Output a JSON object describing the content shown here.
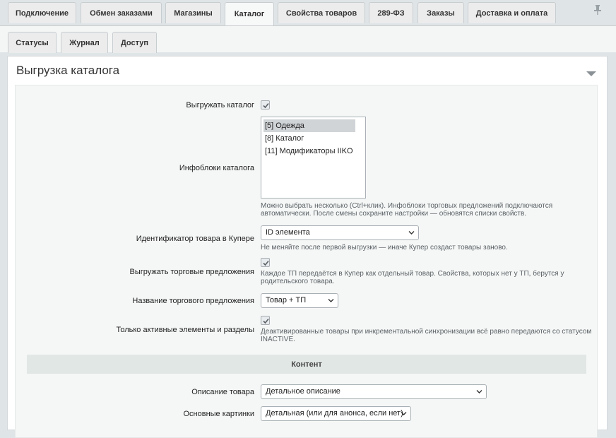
{
  "top_tabs": [
    {
      "label": "Подключение"
    },
    {
      "label": "Обмен заказами"
    },
    {
      "label": "Магазины"
    },
    {
      "label": "Каталог",
      "active": true
    },
    {
      "label": "Свойства товаров"
    },
    {
      "label": "289-ФЗ"
    },
    {
      "label": "Заказы"
    },
    {
      "label": "Доставка и оплата"
    }
  ],
  "sub_tabs": [
    {
      "label": "Статусы"
    },
    {
      "label": "Журнал"
    },
    {
      "label": "Доступ"
    }
  ],
  "panel": {
    "title": "Выгрузка каталога"
  },
  "form": {
    "export_catalog": {
      "label": "Выгружать каталог",
      "checked": true
    },
    "infoblocks": {
      "label": "Инфоблоки каталога",
      "items": [
        {
          "label": "[5] Одежда",
          "selected": true
        },
        {
          "label": "[8] Каталог",
          "selected": false
        },
        {
          "label": "[11] Модификаторы IIKO",
          "selected": false
        }
      ],
      "hint_line1": "Можно выбрать несколько (Ctrl+клик). Инфоблоки торговых предложений подключаются",
      "hint_line2": "автоматически. После смены сохраните настройки — обновятся списки свойств."
    },
    "product_id": {
      "label": "Идентификатор товара в Купере",
      "value": "ID элемента",
      "hint": "Не меняйте после первой выгрузки — иначе Купер создаст товары заново."
    },
    "export_offers": {
      "label": "Выгружать торговые предложения",
      "checked": true,
      "hint_line1": "Каждое ТП передаётся в Купер как отдельный товар. Свойства, которых нет у ТП, берутся у",
      "hint_line2": "родительского товара."
    },
    "offer_name": {
      "label": "Название торгового предложения",
      "value": "Товар + ТП"
    },
    "only_active": {
      "label": "Только активные элементы и разделы",
      "checked": true,
      "hint_line1": "Деактивированные товары при инкрементальной синхронизации всё равно передаются со статусом",
      "hint_line2": "INACTIVE."
    },
    "content_section": {
      "label": "Контент"
    },
    "description": {
      "label": "Описание товара",
      "value": "Детальное описание"
    },
    "main_images": {
      "label": "Основные картинки",
      "value": "Детальная (или для анонса, если нет)"
    }
  },
  "colors": {
    "background": "#dfe5e7",
    "panel": "#ffffff",
    "form_area": "#f5f7f6",
    "section_header": "#e1e7e5",
    "tab": "#ececec"
  },
  "icons": {
    "pin": "pin-icon",
    "collapse": "chevron-down-icon",
    "check": "check-icon",
    "select_arrow": "chevron-down-icon"
  }
}
